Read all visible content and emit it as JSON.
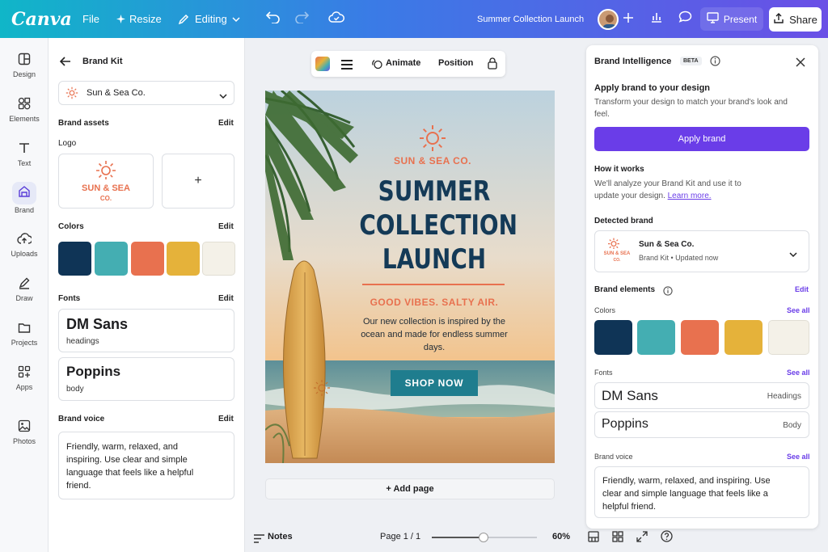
{
  "topbar": {
    "logo": "Canva",
    "file": "File",
    "resize": "Resize",
    "editing": "Editing",
    "doc_title": "Summer Collection Launch",
    "present": "Present",
    "share": "Share"
  },
  "rail": [
    {
      "label": "Design",
      "icon": "design-icon"
    },
    {
      "label": "Elements",
      "icon": "elements-icon"
    },
    {
      "label": "Text",
      "icon": "text-icon"
    },
    {
      "label": "Brand",
      "icon": "brand-icon"
    },
    {
      "label": "Uploads",
      "icon": "uploads-icon"
    },
    {
      "label": "Draw",
      "icon": "draw-icon"
    },
    {
      "label": "Projects",
      "icon": "projects-icon"
    },
    {
      "label": "Apps",
      "icon": "apps-icon"
    },
    {
      "label": "Photos",
      "icon": "photos-icon"
    }
  ],
  "brandkit": {
    "title": "Brand Kit",
    "kit_name": "Sun & Sea Co.",
    "assets_label": "Brand assets",
    "edit": "Edit",
    "logo_label": "Logo",
    "logo_line1": "SUN & SEA",
    "logo_line2": "CO.",
    "add": "+",
    "colors_label": "Colors",
    "colors": [
      "#0f3456",
      "#44aeb2",
      "#e8714f",
      "#e5b23a",
      "#f4f1e8"
    ],
    "fonts_label": "Fonts",
    "fonts": [
      {
        "name": "DM Sans",
        "role": "headings"
      },
      {
        "name": "Poppins",
        "role": "body"
      }
    ],
    "voice_label": "Brand voice",
    "voice_text": "Friendly, warm, relaxed, and inspiring. Use clear and simple language that feels like a helpful friend."
  },
  "toolbar": {
    "animate": "Animate",
    "position": "Position"
  },
  "design": {
    "brand": "SUN & SEA CO.",
    "headline": [
      "SUMMER",
      "COLLECTION",
      "LAUNCH"
    ],
    "tagline": "GOOD VIBES. SALTY AIR.",
    "body": "Our new collection is inspired by the ocean and made for endless summer days.",
    "cta": "SHOP NOW"
  },
  "add_page": "+ Add page",
  "footer": {
    "notes": "Notes",
    "page": "Page 1 / 1",
    "zoom": "60%",
    "zoom_fraction": 0.49
  },
  "brand_intel": {
    "title": "Brand Intelligence",
    "badge": "BETA",
    "apply_title": "Apply brand to your design",
    "apply_desc": "Transform your design to match your brand's look and feel.",
    "apply_btn": "Apply brand",
    "how_title": "How it works",
    "how_desc": "We'll analyze your Brand Kit and use it to update your design.",
    "learn_more": "Learn more.",
    "detected_label": "Detected brand",
    "detected_name": "Sun & Sea Co.",
    "detected_sub": "Brand Kit • Updated now",
    "detected_logo1": "SUN & SEA",
    "detected_logo2": "CO.",
    "elements_label": "Brand elements",
    "edit": "Edit",
    "colors_label": "Colors",
    "see_all": "See all",
    "colors": [
      "#0f3456",
      "#44aeb2",
      "#e8714f",
      "#e5b23a",
      "#f4f1e8"
    ],
    "fonts_label": "Fonts",
    "fonts": [
      {
        "name": "DM Sans",
        "role": "Headings"
      },
      {
        "name": "Poppins",
        "role": "Body"
      }
    ],
    "voice_label": "Brand voice",
    "voice_text": "Friendly, warm, relaxed, and inspiring. Use clear and simple language that feels like a helpful friend."
  }
}
